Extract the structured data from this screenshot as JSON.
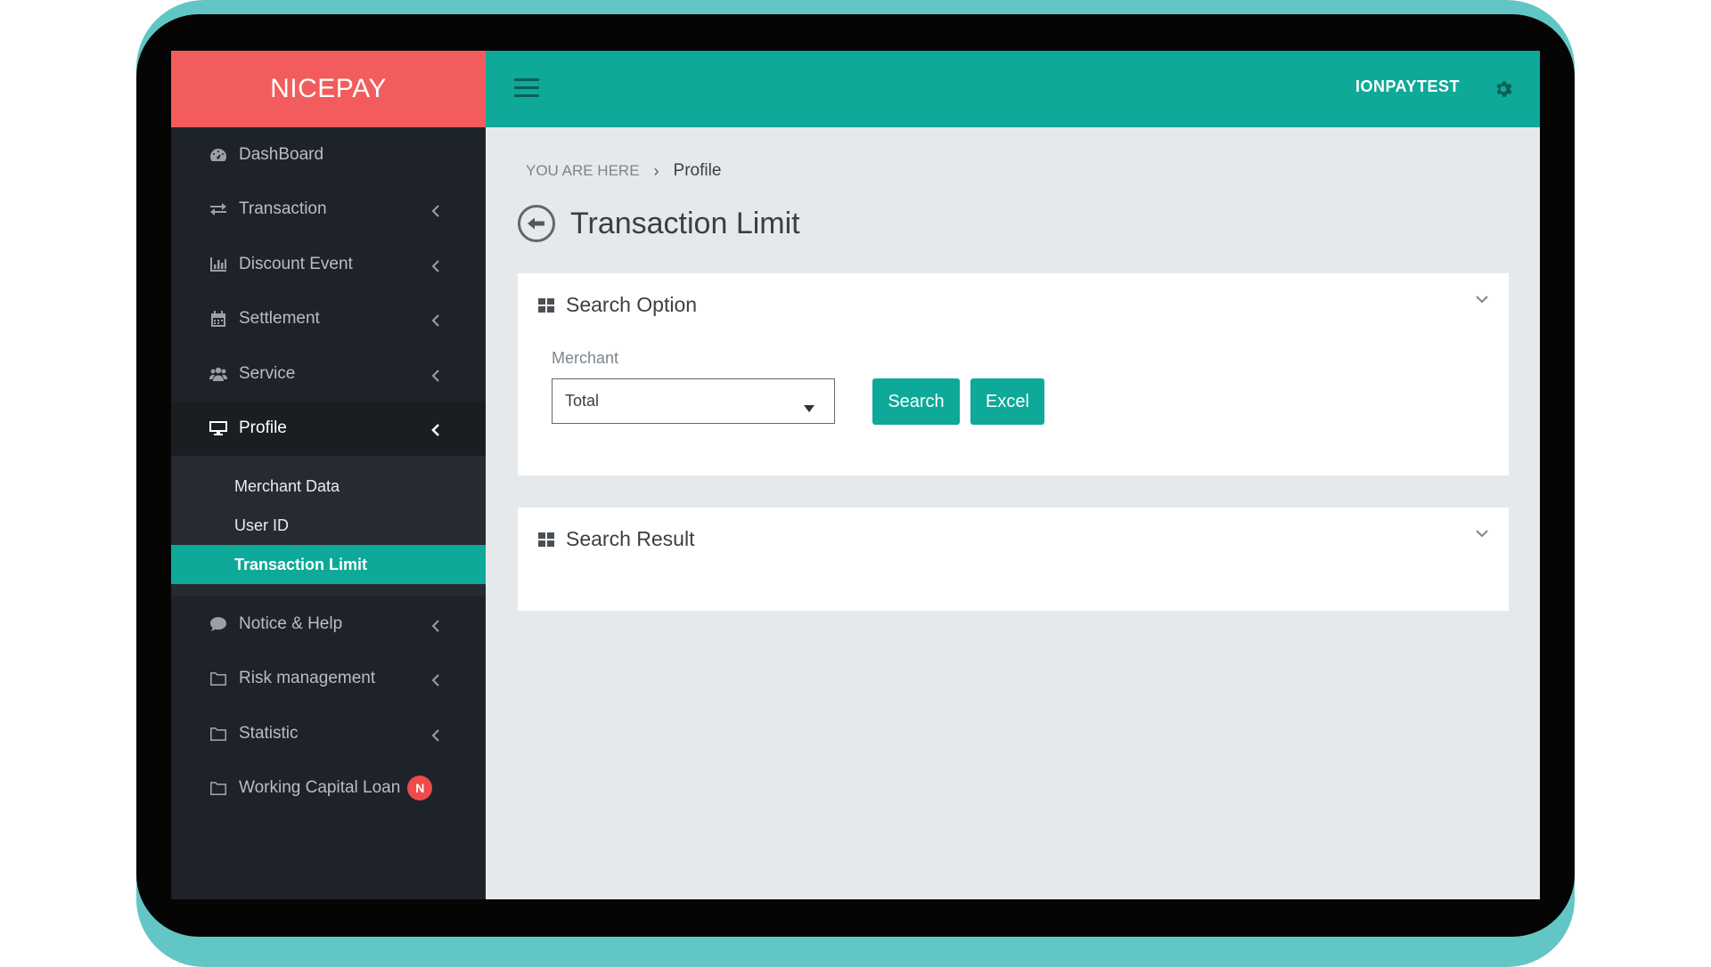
{
  "brand": "NICEPAY",
  "header": {
    "username": "IONPAYTEST"
  },
  "sidebar": {
    "items": [
      {
        "label": "DashBoard",
        "icon": "dashboard-icon"
      },
      {
        "label": "Transaction",
        "icon": "exchange-icon"
      },
      {
        "label": "Discount Event",
        "icon": "bar-chart-icon"
      },
      {
        "label": "Settlement",
        "icon": "calendar-icon"
      },
      {
        "label": "Service",
        "icon": "users-icon"
      },
      {
        "label": "Profile",
        "icon": "monitor-icon"
      },
      {
        "label": "Notice & Help",
        "icon": "comment-icon"
      },
      {
        "label": "Risk management",
        "icon": "folder-icon"
      },
      {
        "label": "Statistic",
        "icon": "folder-icon"
      },
      {
        "label": "Working Capital Loan",
        "icon": "folder-icon",
        "badge": "N"
      }
    ],
    "profile_sub": [
      "Merchant Data",
      "User ID",
      "Transaction Limit"
    ]
  },
  "breadcrumb": {
    "prefix": "YOU ARE HERE",
    "current": "Profile"
  },
  "page": {
    "title": "Transaction Limit"
  },
  "search_option": {
    "title": "Search Option",
    "merchant_label": "Merchant",
    "merchant_value": "Total",
    "search_label": "Search",
    "excel_label": "Excel"
  },
  "search_result": {
    "title": "Search Result"
  },
  "colors": {
    "brand_red": "#f25c5c",
    "accent_teal": "#0ea998",
    "sidebar_bg": "#1e2329",
    "frame_teal": "#62c6c4"
  }
}
